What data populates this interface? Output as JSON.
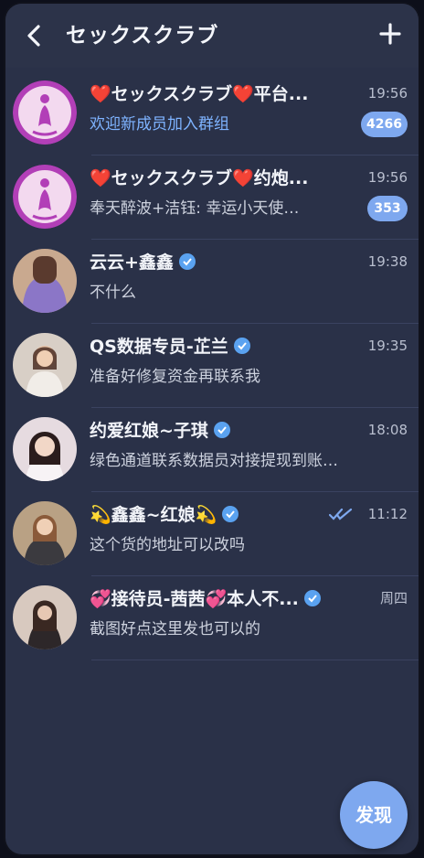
{
  "header": {
    "title": "セックスクラブ",
    "back_icon": "chevron-left-icon",
    "add_icon": "plus-icon"
  },
  "chats": [
    {
      "name_prefix": "❤️",
      "name": "セックスクラブ",
      "name_mid": "❤️",
      "name_suffix": "平台...",
      "time": "19:56",
      "preview": "欢迎新成员加入群组",
      "badge": "4266"
    },
    {
      "name_prefix": "❤️",
      "name": "セックスクラブ",
      "name_mid": "❤️",
      "name_suffix": "约炮...",
      "time": "19:56",
      "preview": "奉天醉波+洁钰: 幸运小天使…",
      "badge": "353"
    },
    {
      "name": "云云+鑫鑫",
      "time": "19:38",
      "preview": "不什么"
    },
    {
      "name": "QS数据专员-芷兰",
      "time": "19:35",
      "preview": "准备好修复资金再联系我"
    },
    {
      "name": "约爱红娘~子琪",
      "time": "18:08",
      "preview": "绿色通道联系数据员对接提现到账…"
    },
    {
      "name_prefix": "💫",
      "name": "鑫鑫~红娘",
      "name_suffix": "💫",
      "time": "11:12",
      "preview": "这个货的地址可以改吗",
      "status": "read-double-check-icon"
    },
    {
      "name_prefix": "💞",
      "name": "接待员-茜茜",
      "name_mid": "💞",
      "name_suffix": "本人不...",
      "time": "周四",
      "preview": "截图好点这里发也可以的"
    }
  ],
  "fab": {
    "label": "发现"
  },
  "colors": {
    "background": "#2a3148",
    "accent": "#7ea8ef",
    "verified": "#5aa2f0",
    "heart": "#ff3b4c"
  }
}
